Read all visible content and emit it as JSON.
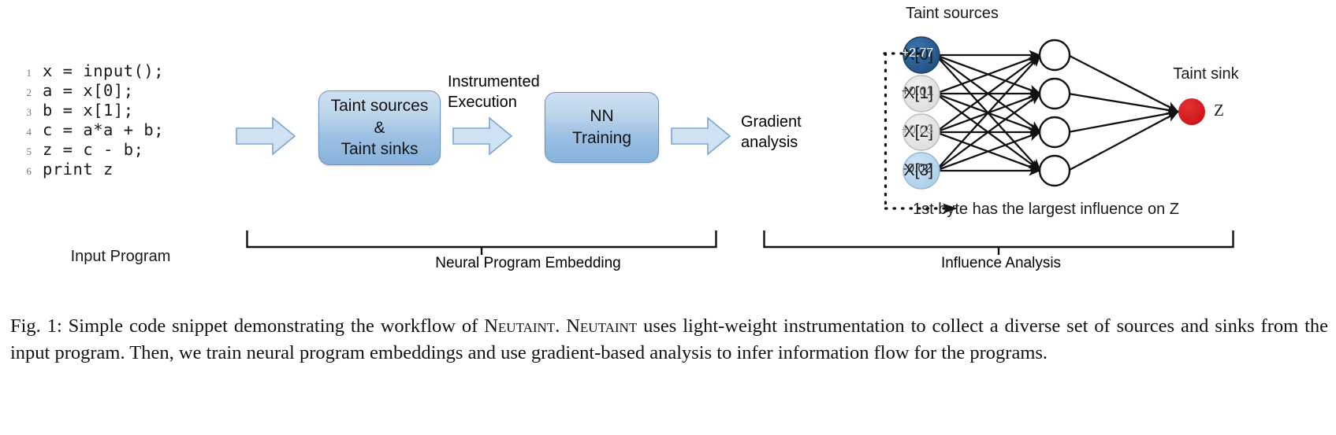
{
  "code": {
    "lines": [
      {
        "num": "1",
        "text": "x = input();"
      },
      {
        "num": "2",
        "text": "a = x[0];"
      },
      {
        "num": "3",
        "text": "b = x[1];"
      },
      {
        "num": "4",
        "text": "c = a*a + b;"
      },
      {
        "num": "5",
        "text": "z = c - b;"
      },
      {
        "num": "6",
        "text": "print z"
      }
    ],
    "caption": "Input Program"
  },
  "pipeline": {
    "box_taint": {
      "line1": "Taint sources",
      "line2": "&",
      "line3": "Taint sinks"
    },
    "box_nn": {
      "line1": "NN",
      "line2": "Training"
    },
    "label_instrumented": {
      "line1": "Instrumented",
      "line2": "Execution"
    },
    "label_gradient": {
      "line1": "Gradient",
      "line2": "analysis"
    },
    "bracket_left_label": "Neural Program Embedding",
    "bracket_right_label": "Influence Analysis",
    "arrow_color": "#cfe2f3",
    "arrow_stroke": "#7ba7d0",
    "box_border": "#6d93bd"
  },
  "network": {
    "title_sources": "Taint sources",
    "title_sink": "Taint sink",
    "output_label": "Z",
    "annotation": "1st byte has the largest influence on Z",
    "input_nodes": [
      {
        "name": "X[0]",
        "value": "+2.77",
        "fill": "#2b5d91",
        "text_color": "#ffffff"
      },
      {
        "name": "X[1]",
        "value": "+0.01",
        "fill": "#e6e6e6",
        "text_color": "#4d4d4d"
      },
      {
        "name": "X[2]",
        "value": "+0.03",
        "fill": "#e2e2e2",
        "text_color": "#9a9a9a"
      },
      {
        "name": "X[3]",
        "value": "-0.02",
        "fill": "#bcd8ef",
        "text_color": "#2b2b2b"
      }
    ],
    "hidden_node_count": 4,
    "hidden_fill": "#ffffff",
    "output_fill": "#d91f22"
  },
  "figure_caption": {
    "prefix": "Fig. 1: Simple code snippet demonstrating the workflow of ",
    "name1": "Neutaint",
    "mid1": ". ",
    "name2": "Neutaint",
    "rest": " uses light-weight instrumentation to collect a diverse set of sources and sinks from the input program. Then, we train neural program embeddings and use gradient-based analysis to infer information flow for the programs."
  }
}
